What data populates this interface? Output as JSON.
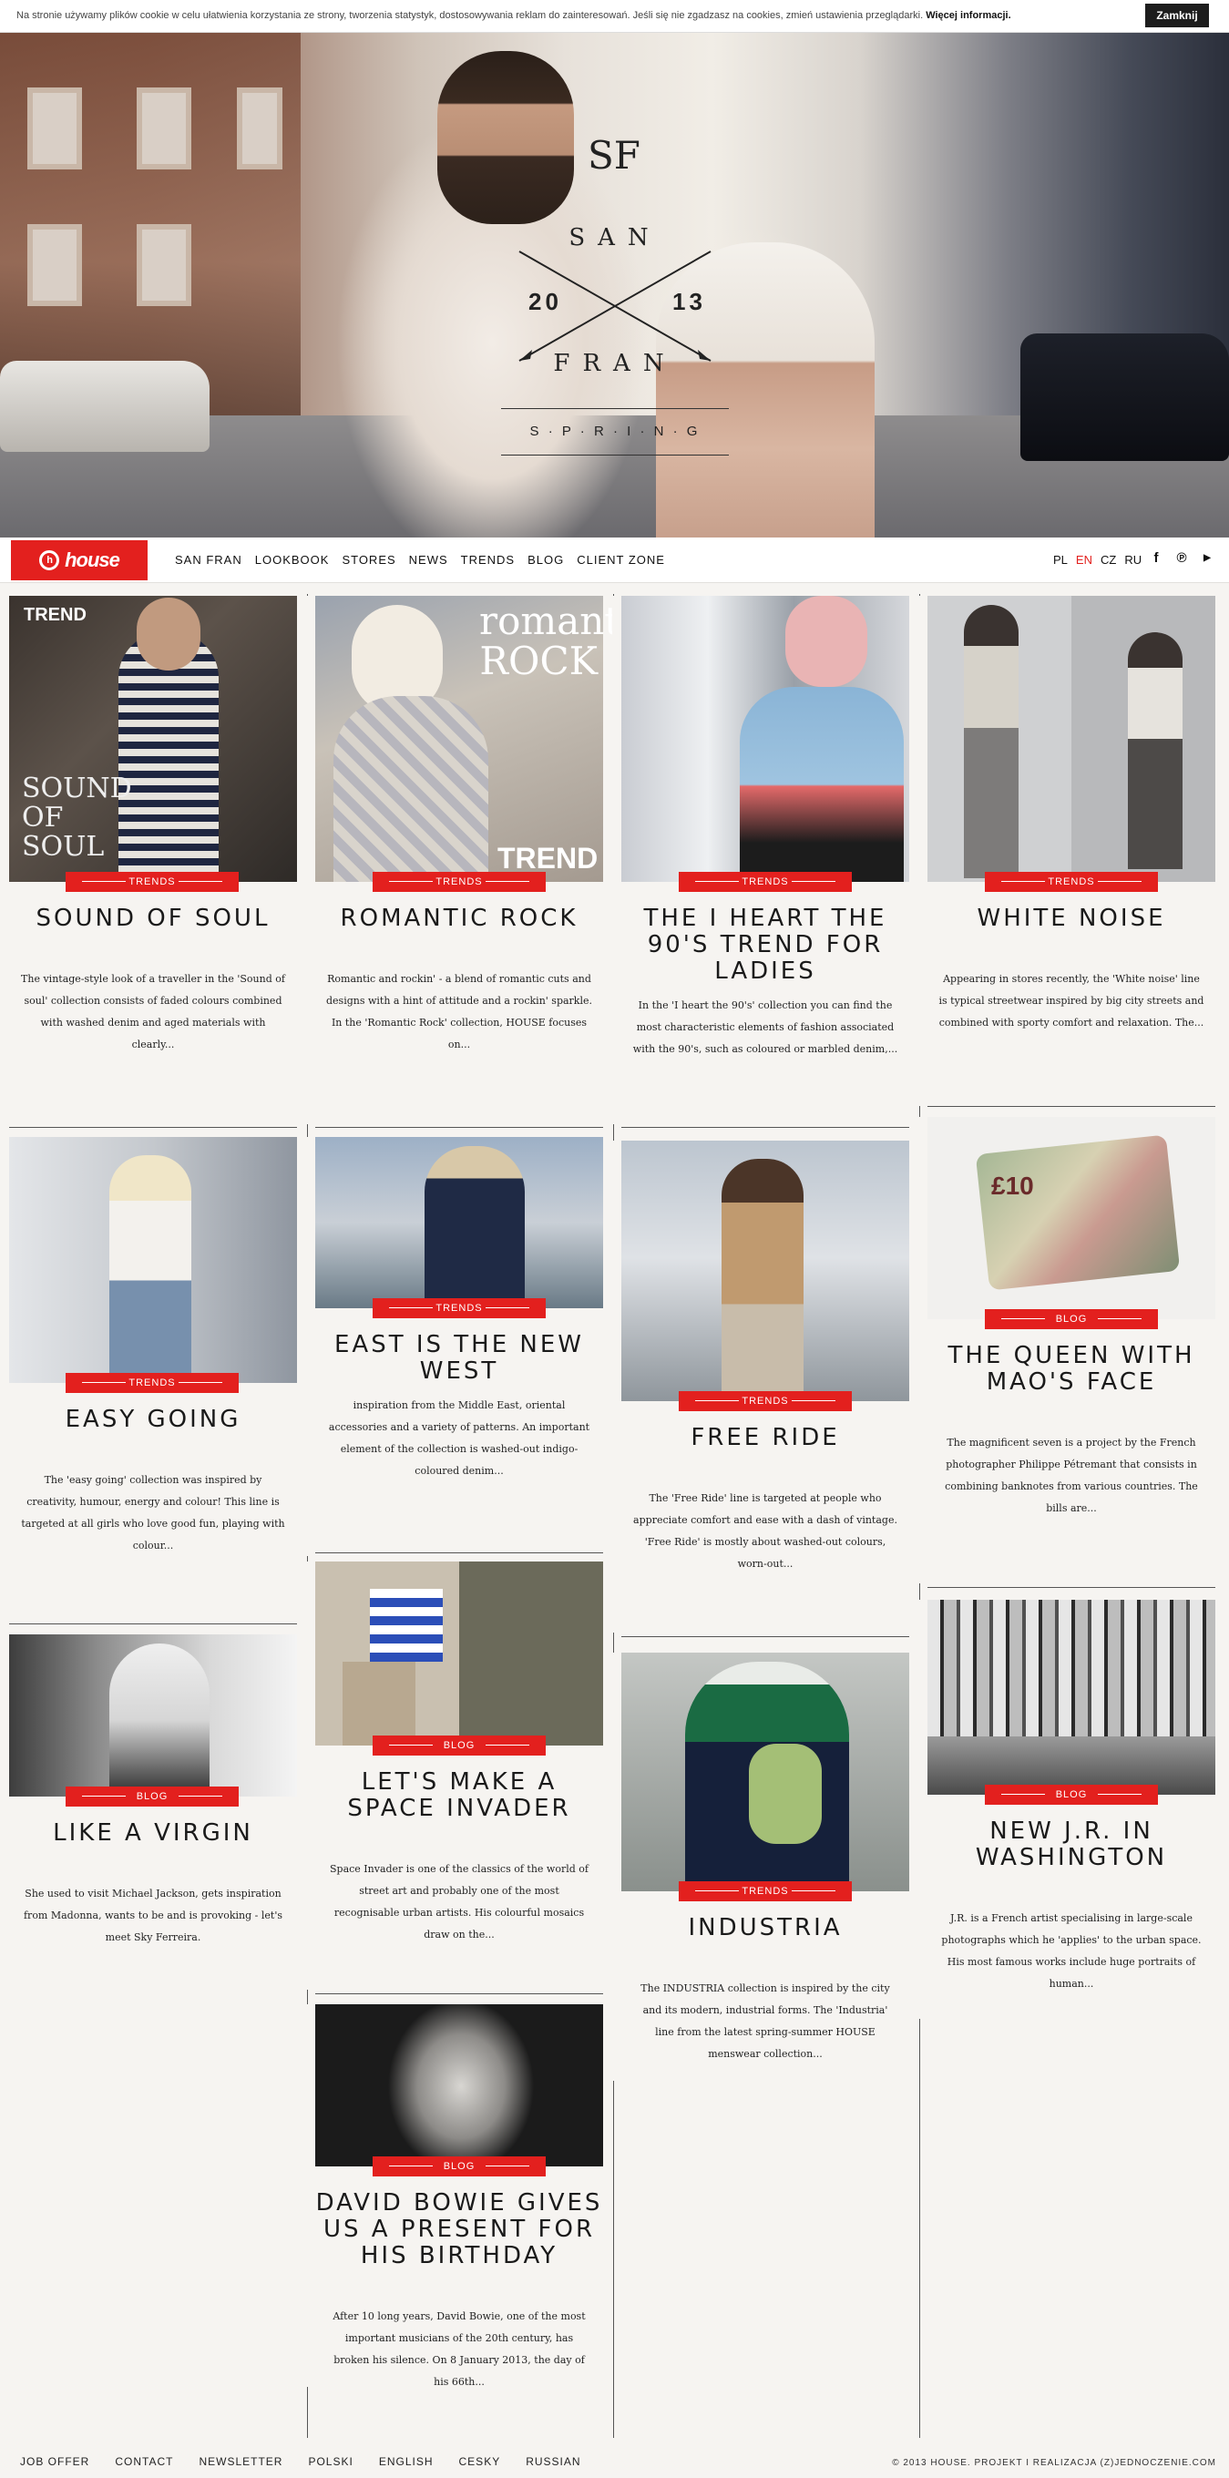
{
  "cookie": {
    "text": "Na stronie używamy plików cookie w celu ułatwienia korzystania ze strony, tworzenia statystyk, dostosowywania reklam do zainteresowań. Jeśli się nie zgadzasz na cookies, zmień ustawienia przeglądarki.",
    "more_link": "Więcej informacji.",
    "close_button": "Zamknij"
  },
  "hero": {
    "monogram": "SF",
    "san": "SAN",
    "year_left": "20",
    "year_right": "13",
    "fran": "FRAN",
    "spring": "S · P · R · I · N · G"
  },
  "nav": {
    "logo": "house",
    "links": [
      "SAN FRAN",
      "LOOKBOOK",
      "STORES",
      "NEWS",
      "TRENDS",
      "BLOG",
      "CLIENT ZONE"
    ],
    "languages": [
      "PL",
      "EN",
      "CZ",
      "RU"
    ],
    "active_language": "EN",
    "social_icons": [
      "facebook-icon",
      "pinterest-icon",
      "youtube-icon"
    ]
  },
  "cards": [
    {
      "tag": "TRENDS",
      "title": "SOUND OF SOUL",
      "desc": "The vintage-style look of a traveller in the 'Sound of soul' collection consists of faded colours combined with washed denim and aged materials with clearly...",
      "overlay": "TREND",
      "overlay2": "SOUND OF SOUL"
    },
    {
      "tag": "TRENDS",
      "title": "ROMANTIC ROCK",
      "desc": "Romantic and rockin' - a blend of romantic cuts and designs with a hint of attitude and a rockin' sparkle. In the 'Romantic Rock' collection, HOUSE focuses on...",
      "overlay": "romantic ROCK",
      "overlay2": "TREND"
    },
    {
      "tag": "TRENDS",
      "title": "THE I HEART THE 90'S TREND FOR LADIES",
      "desc": "In the 'I heart the 90's' collection you can find the most characteristic elements of fashion associated with the 90's, such as coloured or marbled denim,..."
    },
    {
      "tag": "TRENDS",
      "title": "WHITE NOISE",
      "desc": "Appearing in stores recently, the 'White noise' line is typical streetwear inspired by big city streets and combined with sporty comfort and relaxation. The..."
    },
    {
      "tag": "TRENDS",
      "title": "EASY GOING",
      "desc": "The 'easy going' collection was inspired by creativity, humour, energy and colour! This line is targeted at all girls who love good fun, playing with colour..."
    },
    {
      "tag": "TRENDS",
      "title": "EAST IS THE NEW WEST",
      "desc": "inspiration from the Middle East, oriental accessories and a variety of patterns. An important element of the collection is washed-out indigo-coloured denim..."
    },
    {
      "tag": "TRENDS",
      "title": "FREE RIDE",
      "desc": "The 'Free Ride' line is targeted at people who appreciate comfort and ease with a dash of vintage. 'Free Ride' is mostly about washed-out colours, worn-out..."
    },
    {
      "tag": "BLOG",
      "title": "THE QUEEN WITH MAO'S FACE",
      "desc": "The magnificent seven is a project by the French photographer Philippe Pétremant that consists in combining banknotes from various countries. The bills are..."
    },
    {
      "tag": "BLOG",
      "title": "LIKE A VIRGIN",
      "desc": "She used to visit Michael Jackson, gets inspiration from Madonna, wants to be and is provoking - let's meet Sky Ferreira."
    },
    {
      "tag": "BLOG",
      "title": "LET'S MAKE A SPACE INVADER",
      "desc": "Space Invader is one of the classics of the world of street art and probably one of the most recognisable urban artists. His colourful mosaics draw on the..."
    },
    {
      "tag": "TRENDS",
      "title": "INDUSTRIA",
      "desc": "The INDUSTRIA collection is inspired by the city and its modern, industrial forms. The 'Industria' line from the latest spring-summer HOUSE menswear collection..."
    },
    {
      "tag": "BLOG",
      "title": "NEW J.R. IN WASHINGTON",
      "desc": "J.R. is a French artist specialising in large-scale photographs which he 'applies' to the urban space. His most famous works include huge portraits of human..."
    },
    {
      "tag": "BLOG",
      "title": "DAVID BOWIE GIVES US A PRESENT FOR HIS BIRTHDAY",
      "desc": "After 10 long years, David Bowie, one of the most important musicians of the 20th century, has broken his silence. On 8 January 2013, the day of his 66th..."
    }
  ],
  "footer": {
    "links": [
      "JOB OFFER",
      "CONTACT",
      "NEWSLETTER",
      "POLSKI",
      "ENGLISH",
      "CESKY",
      "RUSSIAN"
    ],
    "copyright": "© 2013 HOUSE.   PROJEKT I REALIZACJA (Z)JEDNOCZENIE.COM"
  }
}
